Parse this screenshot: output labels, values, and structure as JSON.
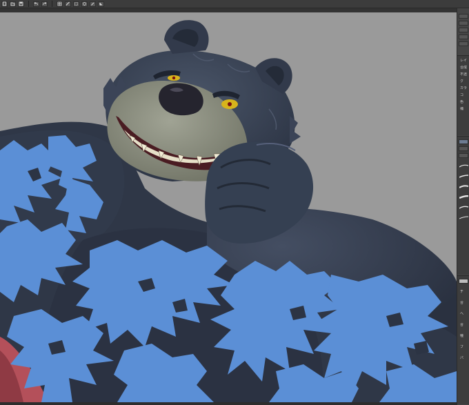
{
  "colors": {
    "canvas_bg": "#9a9a9a",
    "fur_dark": "#2c3444",
    "fur_mid": "#3a4456",
    "fur_blue": "#5b8fd6",
    "muzzle": "#8c8f7e",
    "eye": "#d8b41c",
    "shorts": "#b4505a",
    "ui_dark": "#3a3a3a",
    "ui_accent": "#6d7c92"
  },
  "toolbar": {
    "buttons": [
      "new-file-icon",
      "open-file-icon",
      "save-icon",
      "undo-icon",
      "redo-icon",
      "grid-icon",
      "ruler-icon",
      "transform-icon",
      "snap-icon",
      "pen-icon",
      "fill-icon",
      "hand-icon"
    ]
  },
  "dock": {
    "labels": [
      "レイ",
      "合成",
      "不透",
      "ク",
      "カラ",
      "コ",
      "色",
      "補"
    ],
    "side_labels": [
      "チ",
      "合",
      "ヘ",
      "合",
      "種",
      "ブ",
      "パ"
    ]
  },
  "artwork": {
    "subject": "bear-character",
    "pose": "chin-resting-on-fist"
  }
}
